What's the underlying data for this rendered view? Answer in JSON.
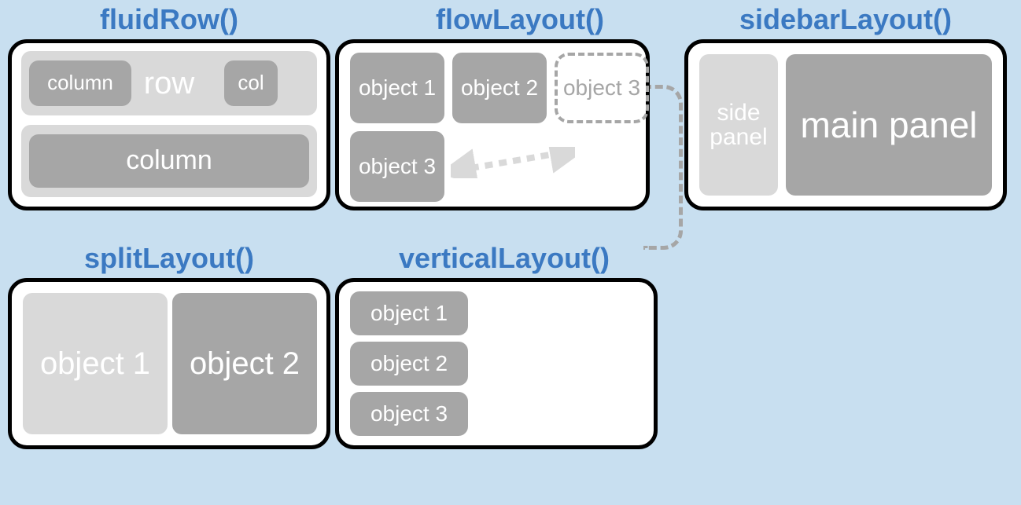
{
  "fluidRow": {
    "title": "fluidRow()",
    "row_label": "row",
    "col1": "column",
    "col2": "col",
    "col3": "column"
  },
  "flowLayout": {
    "title": "flowLayout()",
    "obj1": "object 1",
    "obj2": "object 2",
    "obj3_ghost": "object 3",
    "obj3": "object 3"
  },
  "sidebarLayout": {
    "title": "sidebarLayout()",
    "side": "side panel",
    "main": "main panel"
  },
  "splitLayout": {
    "title": "splitLayout()",
    "obj1": "object 1",
    "obj2": "object 2"
  },
  "verticalLayout": {
    "title": "verticalLayout()",
    "obj1": "object 1",
    "obj2": "object 2",
    "obj3": "object 3"
  }
}
